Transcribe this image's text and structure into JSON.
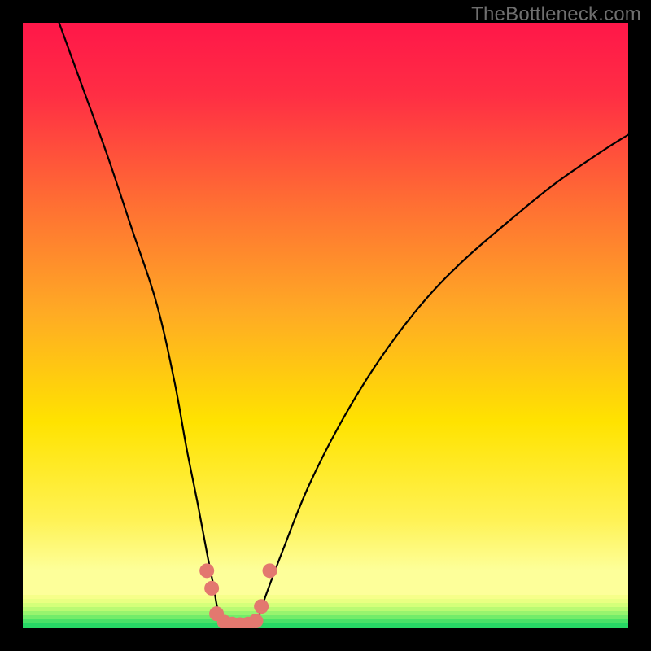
{
  "watermark": "TheBottleneck.com",
  "chart_data": {
    "type": "line",
    "title": "",
    "xlabel": "",
    "ylabel": "",
    "xlim": [
      0,
      100
    ],
    "ylim": [
      0,
      100
    ],
    "grid": false,
    "legend": false,
    "series": [
      {
        "name": "left-branch",
        "x": [
          6,
          10,
          14,
          18,
          22,
          25,
          27,
          29,
          30.5,
          31.5,
          32,
          32.6
        ],
        "y": [
          100,
          89,
          78,
          66,
          54,
          41,
          30,
          20,
          12,
          7,
          4,
          1.2
        ]
      },
      {
        "name": "right-branch",
        "x": [
          38.8,
          40,
          43,
          47,
          52,
          58,
          65,
          72,
          80,
          88,
          96,
          100
        ],
        "y": [
          1.2,
          5,
          13,
          23,
          33,
          43,
          52.5,
          60,
          67,
          73.5,
          79,
          81.5
        ]
      },
      {
        "name": "valley-floor",
        "x": [
          32.6,
          34,
          35.5,
          37.2,
          38.8
        ],
        "y": [
          1.2,
          0.6,
          0.5,
          0.6,
          1.2
        ]
      }
    ],
    "markers": {
      "name": "dots",
      "color": "#e3786f",
      "points": [
        {
          "x": 30.4,
          "y": 9.5
        },
        {
          "x": 31.2,
          "y": 6.6
        },
        {
          "x": 32.0,
          "y": 2.4
        },
        {
          "x": 33.3,
          "y": 1.0
        },
        {
          "x": 34.6,
          "y": 0.7
        },
        {
          "x": 35.9,
          "y": 0.6
        },
        {
          "x": 37.2,
          "y": 0.7
        },
        {
          "x": 38.5,
          "y": 1.2
        },
        {
          "x": 39.4,
          "y": 3.6
        },
        {
          "x": 40.8,
          "y": 9.5
        }
      ]
    },
    "background_gradient": {
      "top": "#ff1749",
      "mid1": "#ff7a2f",
      "mid2": "#ffe300",
      "low": "#fff98a",
      "bottom_band": "#2bdc6a"
    }
  }
}
